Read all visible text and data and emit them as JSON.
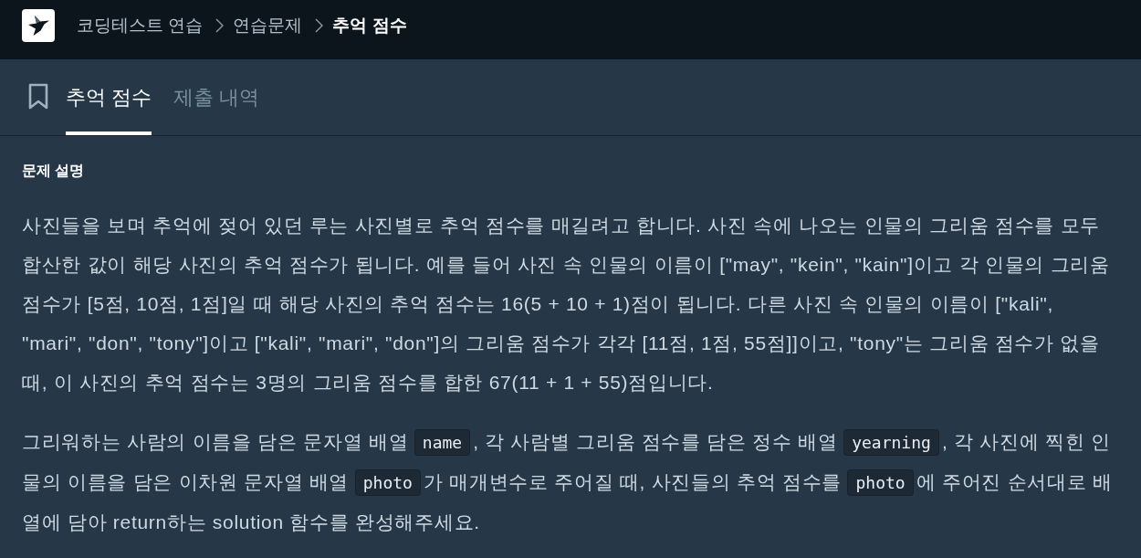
{
  "header": {
    "breadcrumb": [
      {
        "label": "코딩테스트 연습",
        "current": false
      },
      {
        "label": "연습문제",
        "current": false
      },
      {
        "label": "추억 점수",
        "current": true
      }
    ]
  },
  "tab_bar": {
    "tabs": [
      {
        "label": "추억 점수",
        "selected": true
      },
      {
        "label": "제출 내역",
        "selected": false
      }
    ]
  },
  "description": {
    "heading": "문제 설명",
    "paragraphs": [
      [
        {
          "kind": "text",
          "text": "사진들을 보며 추억에 젖어 있던 루는 사진별로 추억 점수를 매길려고 합니다. 사진 속에 나오는 인물의 그리움 점수를 모두 합산한 값이 해당 사진의 추억 점수가 됩니다. 예를 들어 사진 속 인물의 이름이 [\"may\", \"kein\", \"kain\"]이고 각 인물의 그리움 점수가 [5점, 10점, 1점]일 때 해당 사진의 추억 점수는 16(5 + 10 + 1)점이 됩니다. 다른 사진 속 인물의 이름이 [\"kali\", \"mari\", \"don\", \"tony\"]이고 [\"kali\", \"mari\", \"don\"]의 그리움 점수가 각각 [11점, 1점, 55점]]이고, \"tony\"는 그리움 점수가 없을 때, 이 사진의 추억 점수는 3명의 그리움 점수를 합한 67(11 + 1 + 55)점입니다."
        }
      ],
      [
        {
          "kind": "text",
          "text": "그리워하는 사람의 이름을 담은 문자열 배열 "
        },
        {
          "kind": "code",
          "text": "name"
        },
        {
          "kind": "text",
          "text": ", 각 사람별 그리움 점수를 담은 정수 배열 "
        },
        {
          "kind": "code",
          "text": "yearning"
        },
        {
          "kind": "text",
          "text": ", 각 사진에 찍힌 인물의 이름을 담은 이차원 문자열 배열 "
        },
        {
          "kind": "code",
          "text": "photo"
        },
        {
          "kind": "text",
          "text": "가 매개변수로 주어질 때, 사진들의 추억 점수를 "
        },
        {
          "kind": "code",
          "text": "photo"
        },
        {
          "kind": "text",
          "text": "에 주어진 순서대로 배열에 담아 return하는 solution 함수를 완성해주세요."
        }
      ]
    ]
  }
}
